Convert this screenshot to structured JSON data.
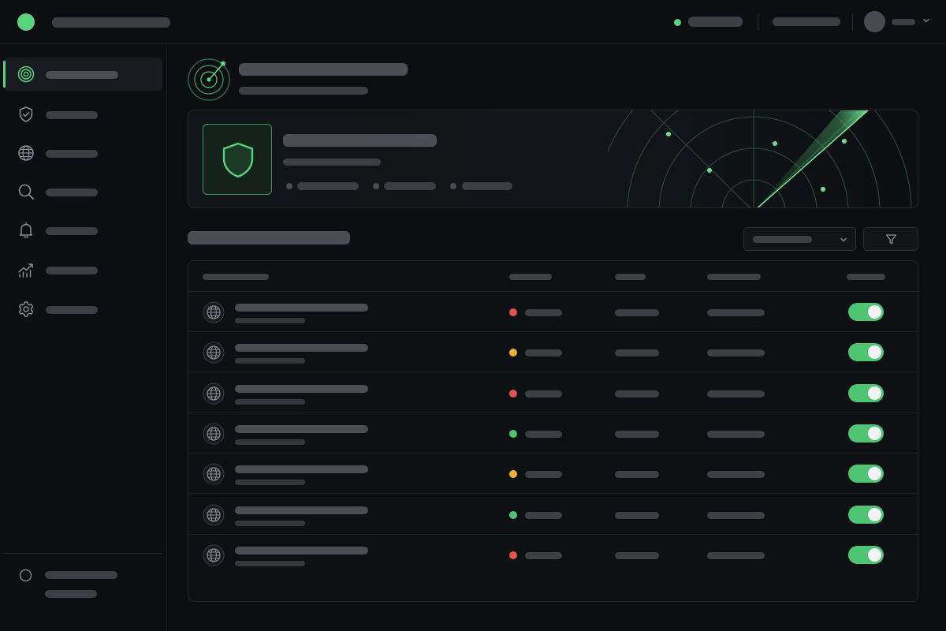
{
  "theme": {
    "accent": "#5bd37d",
    "toggle_on": "#4fc574",
    "background": "#0c0e12",
    "status_colors": {
      "critical": "#e4534a",
      "warning": "#eeb13c",
      "ok": "#4cc670"
    }
  },
  "topbar": {
    "app_title": "",
    "status_text": "",
    "link": "",
    "user_name": "",
    "logo_icon": "green-circle-icon",
    "status_indicator": "online"
  },
  "sidebar": {
    "active_item": "radar",
    "items": [
      {
        "id": "radar",
        "icon": "radar-target-icon",
        "label": ""
      },
      {
        "id": "shield",
        "icon": "shield-check-icon",
        "label": ""
      },
      {
        "id": "globe",
        "icon": "globe-icon",
        "label": ""
      },
      {
        "id": "search",
        "icon": "search-icon",
        "label": ""
      },
      {
        "id": "alerts",
        "icon": "bell-icon",
        "label": ""
      },
      {
        "id": "analytics",
        "icon": "trending-up-icon",
        "label": ""
      },
      {
        "id": "settings",
        "icon": "gear-icon",
        "label": ""
      }
    ],
    "footer": {
      "icon": "circle-icon",
      "line1": "",
      "line2": ""
    }
  },
  "page": {
    "icon": "radar-icon",
    "title": "",
    "subtitle": ""
  },
  "hero": {
    "icon": "shield-icon",
    "title": "",
    "subtitle": "",
    "meta": [
      "",
      "",
      ""
    ]
  },
  "section": {
    "title": "",
    "select_value": "",
    "filter_icon": "filter-icon"
  },
  "table": {
    "columns": [
      "",
      "",
      "",
      "",
      ""
    ],
    "rows": [
      {
        "icon": "globe-icon",
        "name": "",
        "sub": "",
        "status": "critical",
        "status_label": "",
        "col3": "",
        "col4": "",
        "enabled": true
      },
      {
        "icon": "globe-icon",
        "name": "",
        "sub": "",
        "status": "warning",
        "status_label": "",
        "col3": "",
        "col4": "",
        "enabled": true
      },
      {
        "icon": "globe-icon",
        "name": "",
        "sub": "",
        "status": "critical",
        "status_label": "",
        "col3": "",
        "col4": "",
        "enabled": true
      },
      {
        "icon": "globe-icon",
        "name": "",
        "sub": "",
        "status": "ok",
        "status_label": "",
        "col3": "",
        "col4": "",
        "enabled": true
      },
      {
        "icon": "globe-icon",
        "name": "",
        "sub": "",
        "status": "warning",
        "status_label": "",
        "col3": "",
        "col4": "",
        "enabled": true
      },
      {
        "icon": "globe-icon",
        "name": "",
        "sub": "",
        "status": "ok",
        "status_label": "",
        "col3": "",
        "col4": "",
        "enabled": true
      },
      {
        "icon": "globe-icon",
        "name": "",
        "sub": "",
        "status": "critical",
        "status_label": "",
        "col3": "",
        "col4": "",
        "enabled": true
      }
    ]
  }
}
